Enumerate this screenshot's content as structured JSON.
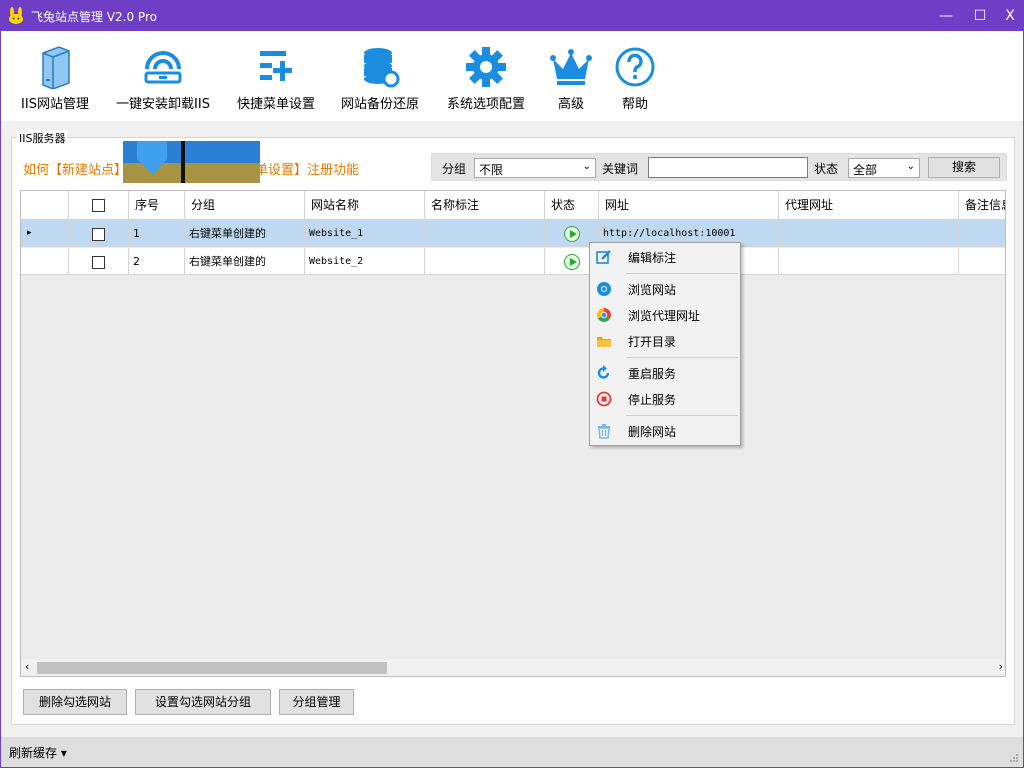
{
  "titlebar": {
    "title": "飞兔站点管理 V2.0 Pro",
    "minimize": "—",
    "maximize": "☐",
    "close": "X"
  },
  "toolbar": {
    "items": [
      {
        "label": "IIS网站管理"
      },
      {
        "label": "一键安装卸载IIS"
      },
      {
        "label": "快捷菜单设置"
      },
      {
        "label": "网站备份还原"
      },
      {
        "label": "系统选项配置"
      },
      {
        "label": "高级"
      },
      {
        "label": "帮助"
      }
    ]
  },
  "group": {
    "title": "IIS服务器"
  },
  "hint": {
    "text_left": "如何【新建站点】",
    "text_right": "单设置】注册功能"
  },
  "filter": {
    "group_label": "分组",
    "group_value": "不限",
    "keyword_label": "关键词",
    "keyword_value": "",
    "status_label": "状态",
    "status_value": "全部",
    "search_button": "搜索"
  },
  "table": {
    "headers": [
      "",
      "",
      "序号",
      "分组",
      "网站名称",
      "名称标注",
      "状态",
      "网址",
      "代理网址",
      "备注信息"
    ],
    "rows": [
      {
        "selected": true,
        "index": "1",
        "group": "右键菜单创建的",
        "name": "Website_1",
        "remark": "",
        "status": "running",
        "url": "http://localhost:10001",
        "proxy": ""
      },
      {
        "selected": false,
        "index": "2",
        "group": "右键菜单创建的",
        "name": "Website_2",
        "remark": "",
        "status": "running",
        "url": "",
        "proxy": ""
      }
    ]
  },
  "context_menu": {
    "items": [
      {
        "label": "编辑标注",
        "icon": "edit-icon"
      },
      {
        "label": "浏览网站",
        "icon": "browser-icon"
      },
      {
        "label": "浏览代理网址",
        "icon": "chrome-icon"
      },
      {
        "label": "打开目录",
        "icon": "folder-icon"
      },
      {
        "label": "重启服务",
        "icon": "restart-icon"
      },
      {
        "label": "停止服务",
        "icon": "stop-icon"
      },
      {
        "label": "删除网站",
        "icon": "trash-icon"
      }
    ]
  },
  "buttons": {
    "delete_checked": "删除勾选网站",
    "set_group": "设置勾选网站分组",
    "group_manage": "分组管理"
  },
  "statusbar": {
    "text": "刷新缓存 ▾"
  },
  "colors": {
    "accent": "#6e3fc6",
    "icon_blue": "#1a8de0",
    "hint_orange": "#e07a00",
    "selected_row": "#bfd9f0"
  }
}
